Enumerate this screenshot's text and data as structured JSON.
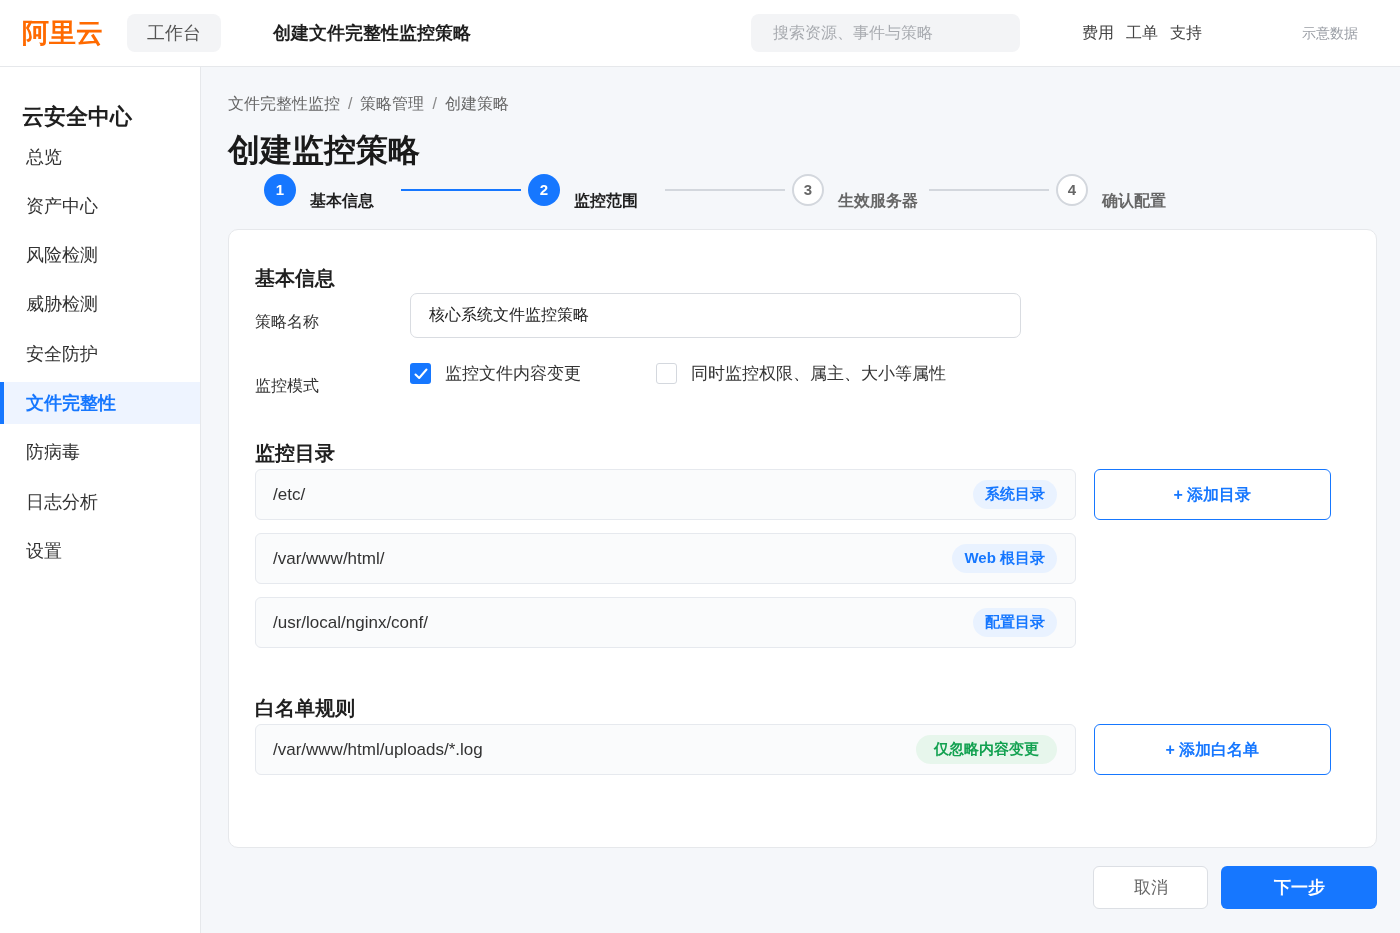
{
  "topbar": {
    "logo": "阿里云",
    "workbench": "工作台",
    "title": "创建文件完整性监控策略",
    "search": {
      "placeholder": "搜索资源、事件与策略"
    },
    "links": [
      "费用",
      "工单",
      "支持"
    ],
    "note": "示意数据"
  },
  "sidebar": {
    "title": "云安全中心",
    "items": [
      {
        "label": "总览",
        "selected": false
      },
      {
        "label": "资产中心",
        "selected": false
      },
      {
        "label": "风险检测",
        "selected": false
      },
      {
        "label": "威胁检测",
        "selected": false
      },
      {
        "label": "安全防护",
        "selected": false
      },
      {
        "label": "文件完整性",
        "selected": true
      },
      {
        "label": "防病毒",
        "selected": false
      },
      {
        "label": "日志分析",
        "selected": false
      },
      {
        "label": "设置",
        "selected": false
      }
    ]
  },
  "breadcrumb": {
    "items": [
      "文件完整性监控",
      "策略管理",
      "创建策略"
    ],
    "separator": "/"
  },
  "page_title": "创建监控策略",
  "steps": [
    {
      "number": "1",
      "label": "基本信息",
      "reached": true
    },
    {
      "number": "2",
      "label": "监控范围",
      "reached": true
    },
    {
      "number": "3",
      "label": "生效服务器",
      "reached": false
    },
    {
      "number": "4",
      "label": "确认配置",
      "reached": false
    }
  ],
  "basic_info": {
    "heading": "基本信息",
    "name_label": "策略名称",
    "name_value": "核心系统文件监控策略",
    "mode_label": "监控模式",
    "mode_options": [
      {
        "label": "监控文件内容变更",
        "checked": true
      },
      {
        "label": "同时监控权限、属主、大小等属性",
        "checked": false
      }
    ]
  },
  "directories": {
    "heading": "监控目录",
    "rows": [
      {
        "path": "/etc/",
        "tag": "系统目录"
      },
      {
        "path": "/var/www/html/",
        "tag": "Web 根目录"
      },
      {
        "path": "/usr/local/nginx/conf/",
        "tag": "配置目录"
      }
    ],
    "add_button": "+ 添加目录"
  },
  "whitelist": {
    "heading": "白名单规则",
    "rows": [
      {
        "path": "/var/www/html/uploads/*.log",
        "tag": "仅忽略内容变更"
      }
    ],
    "add_button": "+ 添加白名单"
  },
  "footer": {
    "buttons": [
      {
        "label": "取消",
        "kind": "secondary"
      },
      {
        "label": "下一步",
        "kind": "primary"
      }
    ]
  }
}
